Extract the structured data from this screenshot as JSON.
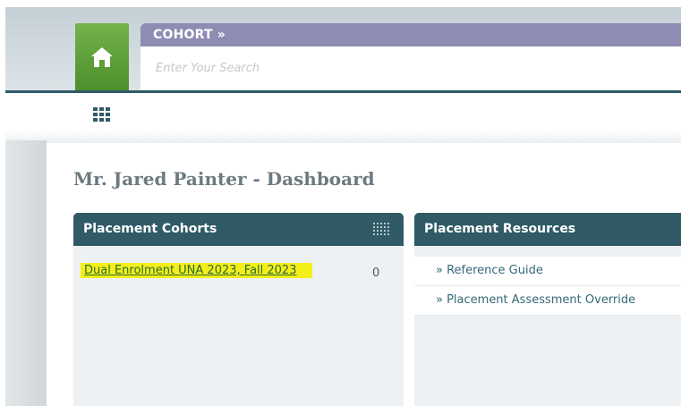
{
  "header": {
    "home_icon": "home-icon",
    "module_label": "COHORT »",
    "search_placeholder": "Enter Your Search"
  },
  "toolbar": {
    "menu_icon": "grid-icon"
  },
  "page": {
    "title": "Mr. Jared Painter - Dashboard"
  },
  "panels": {
    "cohorts": {
      "title": "Placement Cohorts",
      "items": [
        {
          "label": "Dual Enrolment UNA 2023, Fall 2023",
          "count": "0",
          "highlighted": true
        }
      ]
    },
    "resources": {
      "title": "Placement Resources",
      "items": [
        {
          "label": "» Reference Guide"
        },
        {
          "label": "» Placement Assessment Override"
        }
      ]
    }
  },
  "colors": {
    "header_bar": "#2f5a66",
    "home_green": "#5d9f37",
    "module_purple": "#8f8cb4",
    "highlight": "#f4ee1a",
    "link_green": "#2a6a36"
  }
}
